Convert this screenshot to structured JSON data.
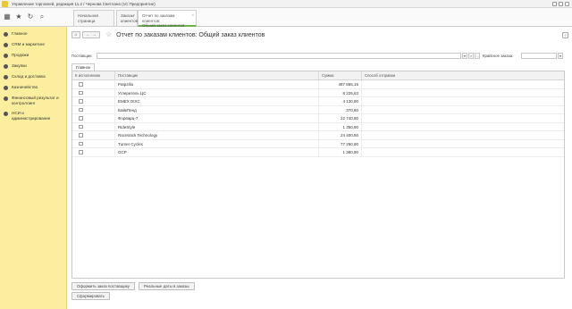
{
  "window": {
    "title": "Управление торговлей, редакция 11.2 / Чернова Светлана (1С:Предприятие)"
  },
  "tabs": [
    {
      "label": "Начальная страница"
    },
    {
      "label": "Заказы клиентов"
    },
    {
      "label_line1": "Отчет по заказам клиентов:",
      "label_line2": "Общий заказ клиентов"
    }
  ],
  "sidebar": {
    "items": [
      {
        "label": "Главное",
        "icon": "home-icon"
      },
      {
        "label": "CRM и маркетинг",
        "icon": "crm-icon"
      },
      {
        "label": "Продажи",
        "icon": "sales-icon"
      },
      {
        "label": "Закупки",
        "icon": "purchases-icon"
      },
      {
        "label": "Склад и доставка",
        "icon": "warehouse-icon"
      },
      {
        "label": "Казначейство",
        "icon": "treasury-icon"
      },
      {
        "label": "Финансовый результат и контроллинг",
        "icon": "finance-icon"
      },
      {
        "label": "НСИ и администрирование",
        "icon": "admin-icon"
      }
    ]
  },
  "page": {
    "title": "Отчет по заказам клиентов: Общий заказ клиентов"
  },
  "filters": {
    "supplier_label": "Поставщик:",
    "supplier_value": "",
    "order_date_label": "Крайсное заказа:",
    "order_date_value": ""
  },
  "subtab": {
    "label": "Главное"
  },
  "table": {
    "columns": [
      "К исполнению",
      "Поставщик",
      "Сумма",
      "Способ отправки"
    ],
    "rows": [
      {
        "supplier": "Patpzilla",
        "sum": "487 865,15",
        "shipping": ""
      },
      {
        "supplier": "Углеритель ЦС",
        "sum": "8 225,63",
        "shipping": ""
      },
      {
        "supplier": "EMEX DIXC",
        "sum": "4 130,80",
        "shipping": ""
      },
      {
        "supplier": "БайкПенд",
        "sum": "370,80",
        "shipping": ""
      },
      {
        "supplier": "Форварц-7",
        "sum": "22 740,80",
        "shipping": ""
      },
      {
        "supplier": "RideStyle",
        "sum": "1 350,80",
        "shipping": ""
      },
      {
        "supplier": "Racetrack Technology",
        "sum": "24 400,80",
        "shipping": ""
      },
      {
        "supplier": "Turner Cycles",
        "sum": "77 250,80",
        "shipping": ""
      },
      {
        "supplier": "GCP",
        "sum": "1 380,80",
        "shipping": ""
      }
    ]
  },
  "buttons": {
    "order_supplier": "Оформить заказ поставщику",
    "real_dates": "Реальные даты в заказы",
    "form": "Сформировать"
  }
}
